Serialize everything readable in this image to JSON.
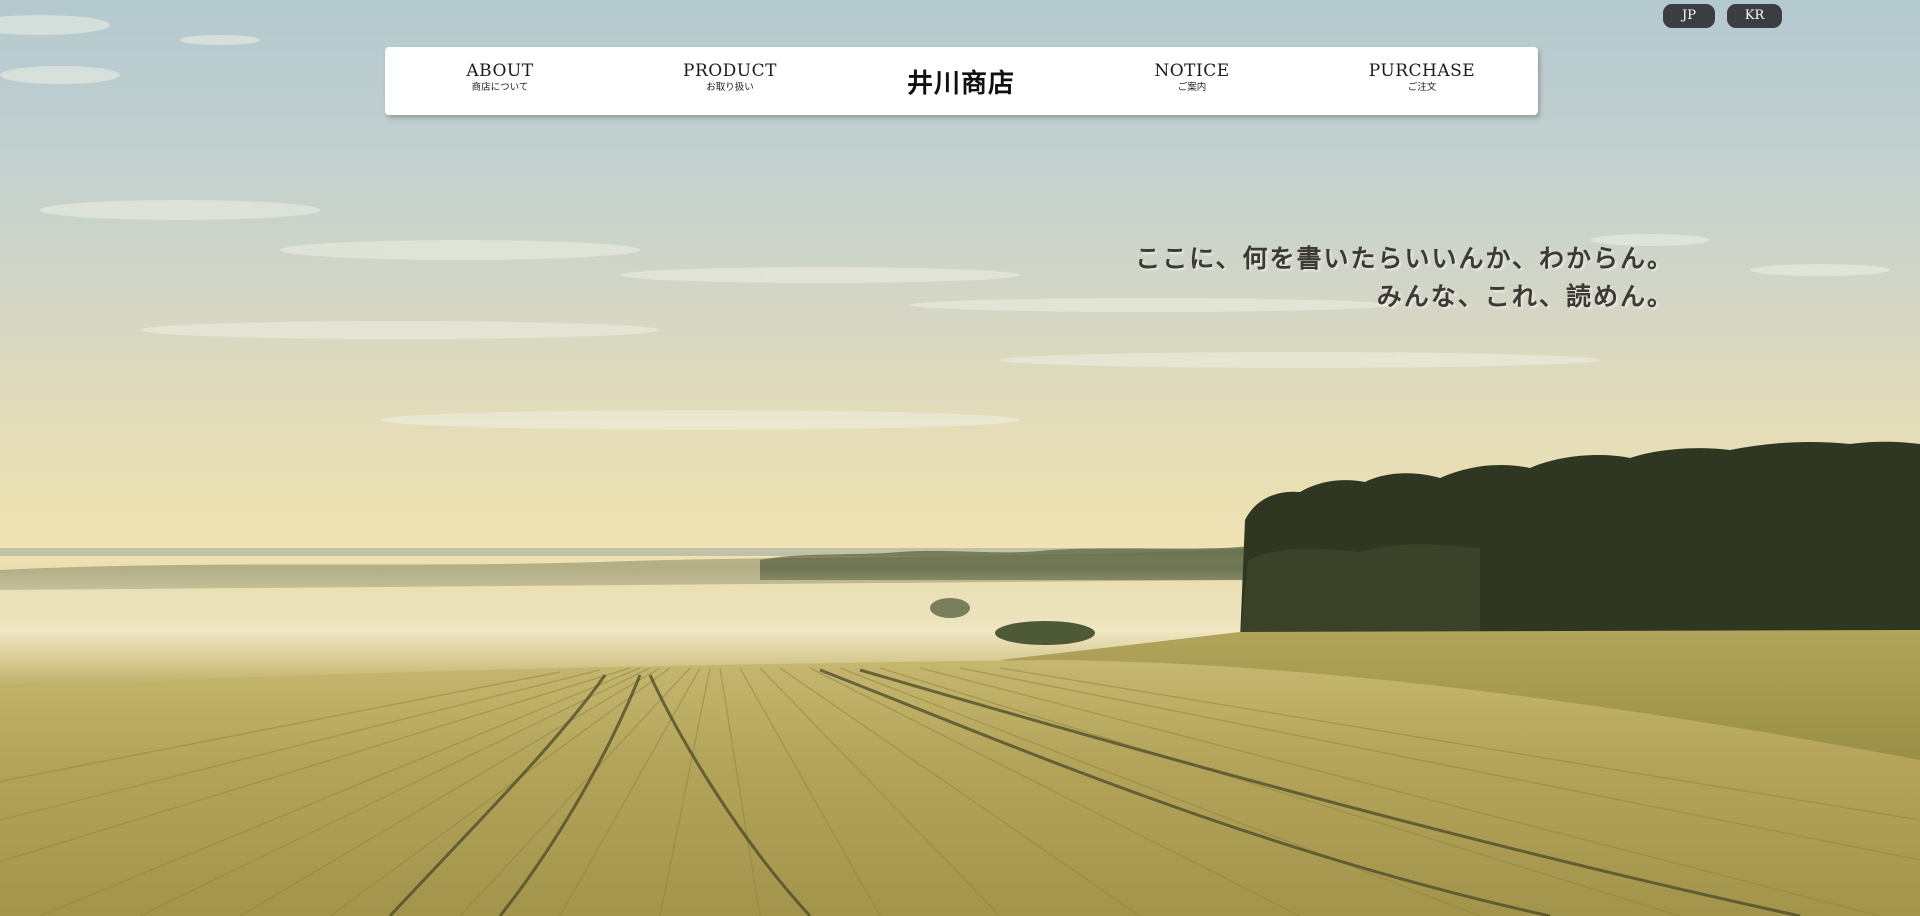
{
  "language_switcher": {
    "jp_label": "JP",
    "kr_label": "KR"
  },
  "nav": {
    "brand": "井川商店",
    "items": [
      {
        "label": "ABOUT",
        "sub": "商店について"
      },
      {
        "label": "PRODUCT",
        "sub": "お取り扱い"
      },
      {
        "label": "NOTICE",
        "sub": "ご案内"
      },
      {
        "label": "PURCHASE",
        "sub": "ご注文"
      }
    ]
  },
  "hero": {
    "tagline_line1": "ここに、何を書いたらいいんか、わからん。",
    "tagline_line2": "みんな、これ、読めん。",
    "background_image": "misty wheat field with tree line at sunrise"
  }
}
